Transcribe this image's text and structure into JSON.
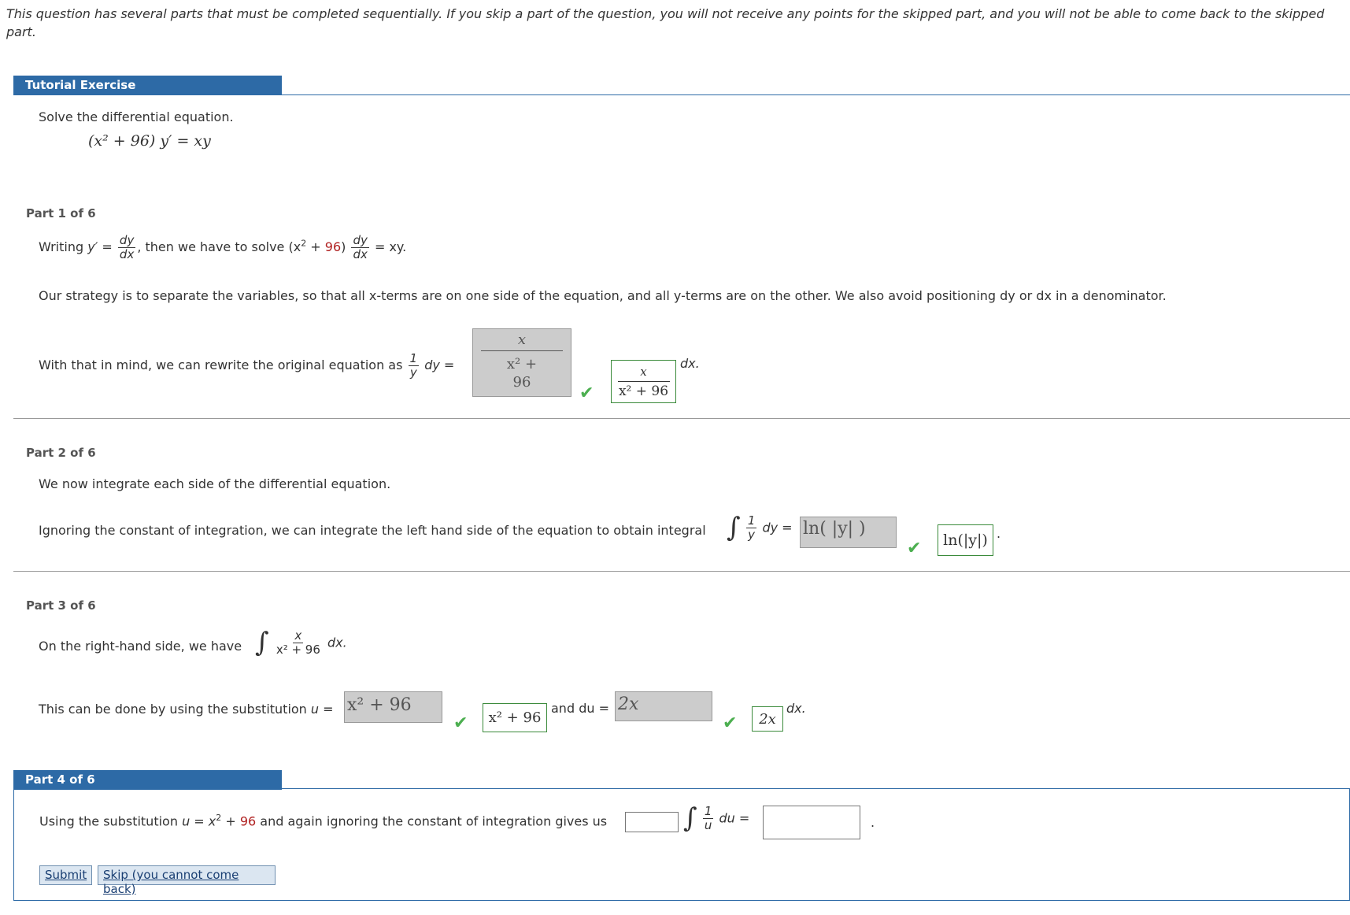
{
  "intro": "This question has several parts that must be completed sequentially. If you skip a part of the question, you will not receive any points for the skipped part, and you will not be able to come back to the skipped part.",
  "tutorial": {
    "title": "Tutorial Exercise",
    "prompt": "Solve the differential equation.",
    "equation": "(x² + 96) y′ = xy"
  },
  "part1": {
    "label": "Part 1 of 6",
    "writing_prefix": "Writing",
    "writing_y": "y′ =",
    "dy": "dy",
    "dx": "dx",
    "then_text": ", then we have to solve",
    "lhs_open": "(x",
    "lhs_exp": "2",
    "lhs_plus": " + ",
    "lhs_num": "96",
    "lhs_close": ")",
    "eq_xy": "= xy.",
    "strategy": "Our strategy is to separate the variables, so that all x-terms are on one side of the equation, and all y-terms are on the other. We also avoid positioning dy or dx in a denominator.",
    "rewrite_prefix": "With that in mind, we can rewrite the original equation as",
    "one": "1",
    "y": "y",
    "dy_eq": "dy =",
    "entered_num": "x",
    "entered_den_1": "x² +",
    "entered_den_2": "96",
    "answer_num": "x",
    "answer_den": "x² + 96",
    "dx_suffix": "dx."
  },
  "part2": {
    "label": "Part 2 of 6",
    "intro": "We now integrate each side of the differential equation.",
    "prefix": "Ignoring the constant of integration, we can integrate the left hand side of the equation to obtain integral",
    "one": "1",
    "y": "y",
    "dy_eq": "dy =",
    "entered": "ln( |y| )",
    "answer": "ln(|y|)",
    "suffix": "."
  },
  "part3": {
    "label": "Part 3 of 6",
    "rhs_prefix": "On the right-hand side, we have",
    "x": "x",
    "den": "x² + 96",
    "dx": "dx.",
    "subst_prefix": "This can be done by using the substitution",
    "u_eq": "u =",
    "entered_u": "x² + 96",
    "answer_u": "x² + 96",
    "and_du": "and du =",
    "entered_du": "2x",
    "answer_du": "2x",
    "dx_suffix": "dx."
  },
  "part4": {
    "label": "Part 4 of 6",
    "prefix": "Using the substitution",
    "u_eq": "u = x",
    "exp": "2",
    "plus": " + ",
    "num": "96",
    "suffix_text": "and again ignoring the constant of integration gives us",
    "one": "1",
    "u": "u",
    "du_eq": "du =",
    "period": ".",
    "submit": "Submit",
    "skip": "Skip (you cannot come back)"
  }
}
